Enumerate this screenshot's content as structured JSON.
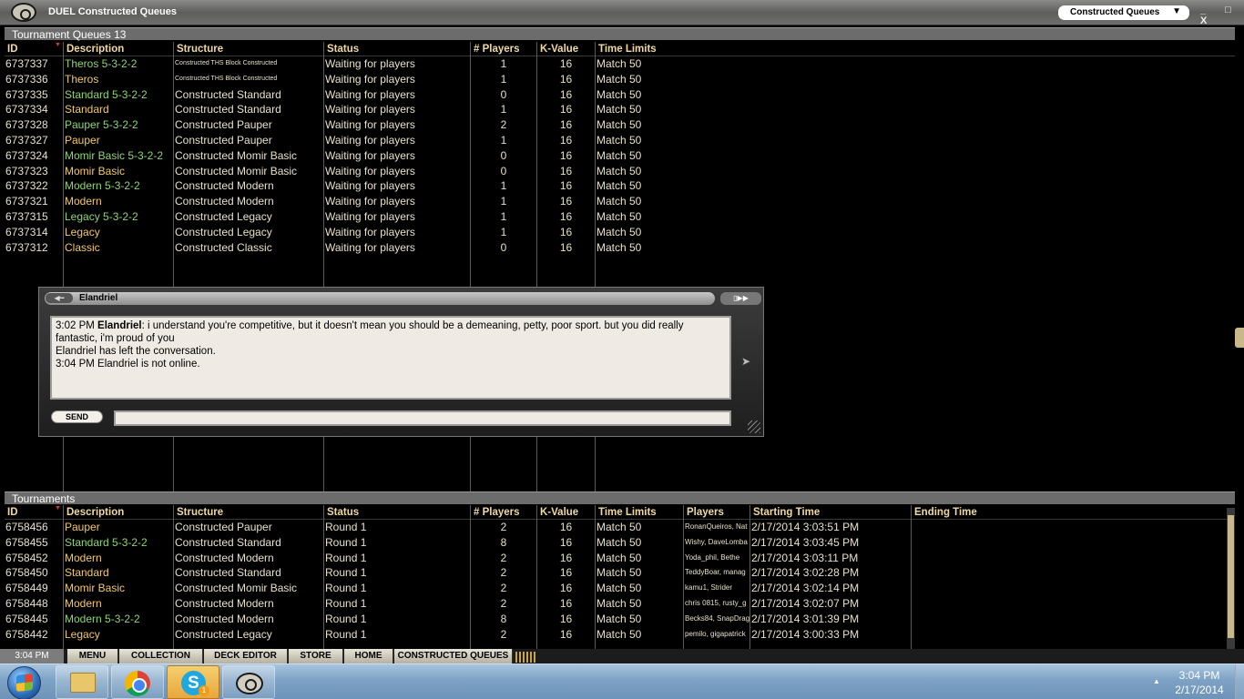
{
  "titlebar": {
    "app_title": "DUEL Constructed Queues",
    "queue_select": "Constructed Queues",
    "window_buttons": "_ □ X",
    "logo_icon": "duel-logo-icon"
  },
  "queues": {
    "header": "Tournament Queues 13",
    "columns": [
      "ID",
      "Description",
      "Structure",
      "Status",
      "# Players",
      "K-Value",
      "Time Limits"
    ],
    "rows": [
      {
        "id": "6737337",
        "description": "Theros 5-3-2-2",
        "structure": "Constructed THS Block Constructed",
        "status": "Waiting for players",
        "players": "1",
        "kvalue": "16",
        "time": "Match 50"
      },
      {
        "id": "6737336",
        "description": "Theros",
        "structure": "Constructed THS Block Constructed",
        "status": "Waiting for players",
        "players": "1",
        "kvalue": "16",
        "time": "Match 50"
      },
      {
        "id": "6737335",
        "description": "Standard 5-3-2-2",
        "structure": "Constructed Standard",
        "status": "Waiting for players",
        "players": "0",
        "kvalue": "16",
        "time": "Match 50"
      },
      {
        "id": "6737334",
        "description": "Standard",
        "structure": "Constructed Standard",
        "status": "Waiting for players",
        "players": "1",
        "kvalue": "16",
        "time": "Match 50"
      },
      {
        "id": "6737328",
        "description": "Pauper 5-3-2-2",
        "structure": "Constructed Pauper",
        "status": "Waiting for players",
        "players": "2",
        "kvalue": "16",
        "time": "Match 50"
      },
      {
        "id": "6737327",
        "description": "Pauper",
        "structure": "Constructed Pauper",
        "status": "Waiting for players",
        "players": "1",
        "kvalue": "16",
        "time": "Match 50"
      },
      {
        "id": "6737324",
        "description": "Momir Basic 5-3-2-2",
        "structure": "Constructed Momir Basic",
        "status": "Waiting for players",
        "players": "0",
        "kvalue": "16",
        "time": "Match 50"
      },
      {
        "id": "6737323",
        "description": "Momir Basic",
        "structure": "Constructed Momir Basic",
        "status": "Waiting for players",
        "players": "0",
        "kvalue": "16",
        "time": "Match 50"
      },
      {
        "id": "6737322",
        "description": "Modern 5-3-2-2",
        "structure": "Constructed Modern",
        "status": "Waiting for players",
        "players": "1",
        "kvalue": "16",
        "time": "Match 50"
      },
      {
        "id": "6737321",
        "description": "Modern",
        "structure": "Constructed Modern",
        "status": "Waiting for players",
        "players": "1",
        "kvalue": "16",
        "time": "Match 50"
      },
      {
        "id": "6737315",
        "description": "Legacy 5-3-2-2",
        "structure": "Constructed Legacy",
        "status": "Waiting for players",
        "players": "1",
        "kvalue": "16",
        "time": "Match 50"
      },
      {
        "id": "6737314",
        "description": "Legacy",
        "structure": "Constructed Legacy",
        "status": "Waiting for players",
        "players": "1",
        "kvalue": "16",
        "time": "Match 50"
      },
      {
        "id": "6737312",
        "description": "Classic",
        "structure": "Constructed Classic",
        "status": "Waiting for players",
        "players": "0",
        "kvalue": "16",
        "time": "Match 50"
      }
    ]
  },
  "chat": {
    "contact": "Elandriel",
    "back_label": "◀━",
    "controls_label": "▯▶▶",
    "log": [
      {
        "time": "3:02 PM",
        "speaker": "Elandriel",
        "text": ": i understand you're competitive, but it doesn't mean you should be a demeaning, petty, poor sport. but you did really fantastic, i'm proud of you"
      },
      {
        "time": "",
        "speaker": "",
        "text": "Elandriel has left the conversation."
      },
      {
        "time": "3:04 PM",
        "speaker": "",
        "text": "Elandriel is not online."
      }
    ],
    "send_label": "SEND",
    "input_value": ""
  },
  "tournaments": {
    "header": "Tournaments",
    "columns": [
      "ID",
      "Description",
      "Structure",
      "Status",
      "# Players",
      "K-Value",
      "Time Limits",
      "Players",
      "Starting Time",
      "Ending Time"
    ],
    "rows": [
      {
        "id": "6758456",
        "description": "Pauper",
        "structure": "Constructed Pauper",
        "status": "Round 1",
        "players": "2",
        "kvalue": "16",
        "time": "Match 50",
        "names": "RonanQueiros, Nat",
        "start": "2/17/2014 3:03:51 PM",
        "end": ""
      },
      {
        "id": "6758455",
        "description": "Standard 5-3-2-2",
        "structure": "Constructed Standard",
        "status": "Round 1",
        "players": "8",
        "kvalue": "16",
        "time": "Match 50",
        "names": "Wishy, DaveLomba",
        "start": "2/17/2014 3:03:45 PM",
        "end": ""
      },
      {
        "id": "6758452",
        "description": "Modern",
        "structure": "Constructed Modern",
        "status": "Round 1",
        "players": "2",
        "kvalue": "16",
        "time": "Match 50",
        "names": "Yoda_phil, Bethe",
        "start": "2/17/2014 3:03:11 PM",
        "end": ""
      },
      {
        "id": "6758450",
        "description": "Standard",
        "structure": "Constructed Standard",
        "status": "Round 1",
        "players": "2",
        "kvalue": "16",
        "time": "Match 50",
        "names": "TeddyBoar, manag",
        "start": "2/17/2014 3:02:28 PM",
        "end": ""
      },
      {
        "id": "6758449",
        "description": "Momir Basic",
        "structure": "Constructed Momir Basic",
        "status": "Round 1",
        "players": "2",
        "kvalue": "16",
        "time": "Match 50",
        "names": "kamu1, Strider",
        "start": "2/17/2014 3:02:14 PM",
        "end": ""
      },
      {
        "id": "6758448",
        "description": "Modern",
        "structure": "Constructed Modern",
        "status": "Round 1",
        "players": "2",
        "kvalue": "16",
        "time": "Match 50",
        "names": "chris 0815, rusty_g",
        "start": "2/17/2014 3:02:07 PM",
        "end": ""
      },
      {
        "id": "6758445",
        "description": "Modern 5-3-2-2",
        "structure": "Constructed Modern",
        "status": "Round 1",
        "players": "8",
        "kvalue": "16",
        "time": "Match 50",
        "names": "Becks84, SnapDrag",
        "start": "2/17/2014 3:01:39 PM",
        "end": ""
      },
      {
        "id": "6758442",
        "description": "Legacy",
        "structure": "Constructed Legacy",
        "status": "Round 1",
        "players": "2",
        "kvalue": "16",
        "time": "Match 50",
        "names": "pemilo, gigapatrick",
        "start": "2/17/2014 3:00:33 PM",
        "end": ""
      }
    ]
  },
  "nav": {
    "clock": "3:04 PM",
    "items": [
      "MENU",
      "COLLECTION",
      "DECK EDITOR",
      "STORE",
      "HOME",
      "CONSTRUCTED QUEUES"
    ]
  },
  "taskbar": {
    "time": "3:04 PM",
    "date": "2/17/2014",
    "skype_badge": "1",
    "skype_letter": "S",
    "apps": [
      "folder-icon",
      "chrome-icon",
      "skype-icon",
      "duel-icon"
    ]
  },
  "colors": {
    "text_default": "#e8e0c8",
    "text_green": "#8fd473",
    "text_orange": "#f2c86a",
    "header_gold": "#f0d9a0"
  }
}
